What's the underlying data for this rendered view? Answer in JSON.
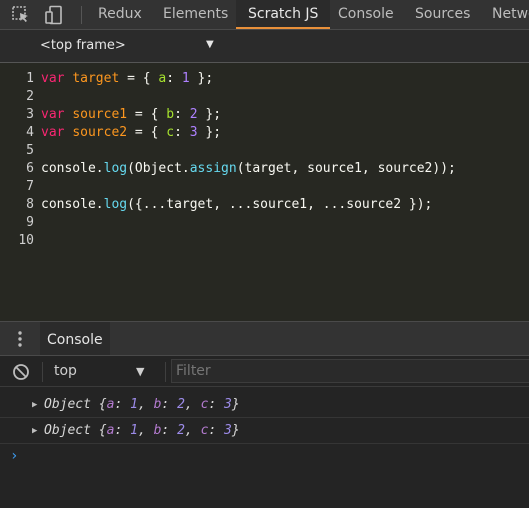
{
  "tabs": {
    "items": [
      {
        "label": "Redux"
      },
      {
        "label": "Elements"
      },
      {
        "label": "Scratch JS"
      },
      {
        "label": "Console"
      },
      {
        "label": "Sources"
      },
      {
        "label": "Netwo"
      }
    ],
    "active": "Scratch JS",
    "accent": "#e8903a"
  },
  "frame": {
    "label": "<top frame>"
  },
  "editor": {
    "lines": [
      {
        "n": "1",
        "parts": [
          [
            "kw",
            "var"
          ],
          [
            "pl",
            " "
          ],
          [
            "var",
            "target"
          ],
          [
            "pl",
            " = { "
          ],
          [
            "prop",
            "a"
          ],
          [
            "pl",
            ": "
          ],
          [
            "num",
            "1"
          ],
          [
            "pl",
            " };"
          ]
        ]
      },
      {
        "n": "2",
        "parts": []
      },
      {
        "n": "3",
        "parts": [
          [
            "kw",
            "var"
          ],
          [
            "pl",
            " "
          ],
          [
            "var",
            "source1"
          ],
          [
            "pl",
            " = { "
          ],
          [
            "prop",
            "b"
          ],
          [
            "pl",
            ": "
          ],
          [
            "num",
            "2"
          ],
          [
            "pl",
            " };"
          ]
        ]
      },
      {
        "n": "4",
        "parts": [
          [
            "kw",
            "var"
          ],
          [
            "pl",
            " "
          ],
          [
            "var",
            "source2"
          ],
          [
            "pl",
            " = { "
          ],
          [
            "prop",
            "c"
          ],
          [
            "pl",
            ": "
          ],
          [
            "num",
            "3"
          ],
          [
            "pl",
            " };"
          ]
        ]
      },
      {
        "n": "5",
        "parts": []
      },
      {
        "n": "6",
        "parts": [
          [
            "pl",
            "console."
          ],
          [
            "fn",
            "log"
          ],
          [
            "pl",
            "(Object."
          ],
          [
            "fn",
            "assign"
          ],
          [
            "pl",
            "(target, source1, source2));"
          ]
        ]
      },
      {
        "n": "7",
        "parts": []
      },
      {
        "n": "8",
        "parts": [
          [
            "pl",
            "console."
          ],
          [
            "fn",
            "log"
          ],
          [
            "pl",
            "({...target, ...source1, ...source2 });"
          ]
        ]
      },
      {
        "n": "9",
        "parts": []
      },
      {
        "n": "10",
        "parts": []
      }
    ]
  },
  "drawer": {
    "tab_label": "Console"
  },
  "console_toolbar": {
    "context": "top",
    "filter_placeholder": "Filter"
  },
  "messages": [
    {
      "name": "Object",
      "props": [
        [
          "a",
          "1"
        ],
        [
          "b",
          "2"
        ],
        [
          "c",
          "3"
        ]
      ]
    },
    {
      "name": "Object",
      "props": [
        [
          "a",
          "1"
        ],
        [
          "b",
          "2"
        ],
        [
          "c",
          "3"
        ]
      ]
    }
  ],
  "prompt": "›",
  "icons": [
    "inspect-icon",
    "device-toolbar-icon",
    "kebab-menu-icon",
    "clear-console-icon",
    "expand-triangle-icon"
  ]
}
